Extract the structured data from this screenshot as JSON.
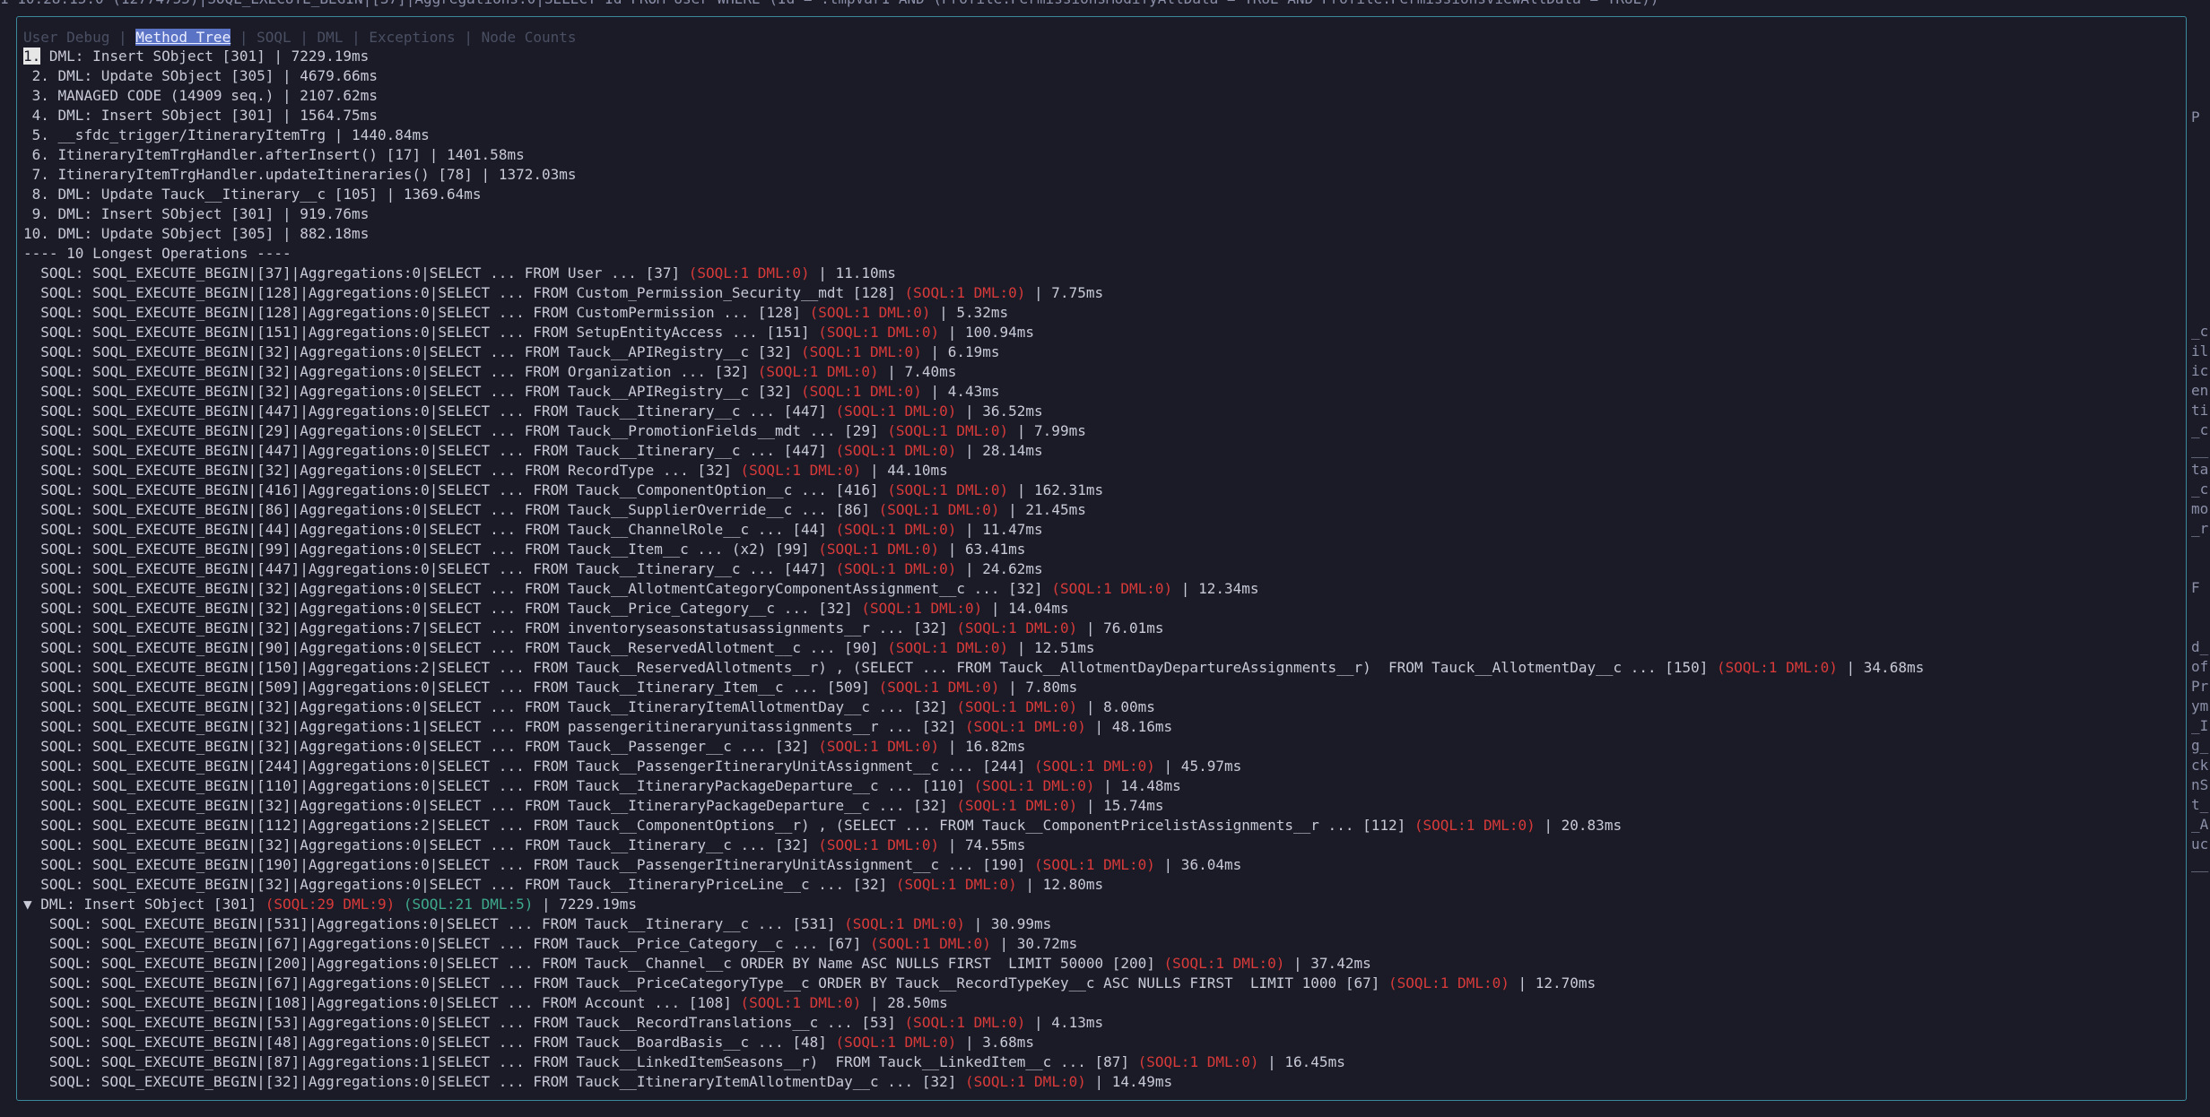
{
  "top_bar": "1 10:28:15.0 (12774755)|SOQL_EXECUTE_BEGIN|[37]|Aggregations:0|SELECT Id FROM User WHERE (Id = :tmpVar1 AND (Profile.PermissionsModifyAllData = TRUE AND Profile.PermissionsViewAllData = TRUE))",
  "tabs": [
    {
      "label": "User Debug",
      "active": false
    },
    {
      "label": "Method Tree",
      "active": true
    },
    {
      "label": "SOQL",
      "active": false
    },
    {
      "label": "DML",
      "active": false
    },
    {
      "label": "Exceptions",
      "active": false
    },
    {
      "label": "Node Counts",
      "active": false
    }
  ],
  "tab_separator": " | ",
  "longest": [
    {
      "prefix": "",
      "num": "1.",
      "text": " DML: Insert SObject [301] | 7229.19ms"
    },
    {
      "prefix": " ",
      "num": "2.",
      "text": " DML: Update SObject [305] | 4679.66ms"
    },
    {
      "prefix": " ",
      "num": "3.",
      "text": " MANAGED CODE (14909 seq.) | 2107.62ms"
    },
    {
      "prefix": " ",
      "num": "4.",
      "text": " DML: Insert SObject [301] | 1564.75ms"
    },
    {
      "prefix": " ",
      "num": "5.",
      "text": " __sfdc_trigger/ItineraryItemTrg | 1440.84ms"
    },
    {
      "prefix": " ",
      "num": "6.",
      "text": " ItineraryItemTrgHandler.afterInsert() [17] | 1401.58ms"
    },
    {
      "prefix": " ",
      "num": "7.",
      "text": " ItineraryItemTrgHandler.updateItineraries() [78] | 1372.03ms"
    },
    {
      "prefix": " ",
      "num": "8.",
      "text": " DML: Update Tauck__Itinerary__c [105] | 1369.64ms"
    },
    {
      "prefix": " ",
      "num": "9.",
      "text": " DML: Insert SObject [301] | 919.76ms"
    },
    {
      "prefix": "",
      "num": "10.",
      "text": " DML: Update SObject [305] | 882.18ms"
    }
  ],
  "longest_footer": "---- 10 Longest Operations ----",
  "soql_badge": "(SOQL:1 DML:0)",
  "soql_lines": [
    {
      "q": "  SOQL: SOQL_EXECUTE_BEGIN|[37]|Aggregations:0|SELECT ... FROM User ... [37] ",
      "t": " | 11.10ms"
    },
    {
      "q": "  SOQL: SOQL_EXECUTE_BEGIN|[128]|Aggregations:0|SELECT ... FROM Custom_Permission_Security__mdt [128] ",
      "t": " | 7.75ms"
    },
    {
      "q": "  SOQL: SOQL_EXECUTE_BEGIN|[128]|Aggregations:0|SELECT ... FROM CustomPermission ... [128] ",
      "t": " | 5.32ms"
    },
    {
      "q": "  SOQL: SOQL_EXECUTE_BEGIN|[151]|Aggregations:0|SELECT ... FROM SetupEntityAccess ... [151] ",
      "t": " | 100.94ms"
    },
    {
      "q": "  SOQL: SOQL_EXECUTE_BEGIN|[32]|Aggregations:0|SELECT ... FROM Tauck__APIRegistry__c [32] ",
      "t": " | 6.19ms"
    },
    {
      "q": "  SOQL: SOQL_EXECUTE_BEGIN|[32]|Aggregations:0|SELECT ... FROM Organization ... [32] ",
      "t": " | 7.40ms"
    },
    {
      "q": "  SOQL: SOQL_EXECUTE_BEGIN|[32]|Aggregations:0|SELECT ... FROM Tauck__APIRegistry__c [32] ",
      "t": " | 4.43ms"
    },
    {
      "q": "  SOQL: SOQL_EXECUTE_BEGIN|[447]|Aggregations:0|SELECT ... FROM Tauck__Itinerary__c ... [447] ",
      "t": " | 36.52ms"
    },
    {
      "q": "  SOQL: SOQL_EXECUTE_BEGIN|[29]|Aggregations:0|SELECT ... FROM Tauck__PromotionFields__mdt ... [29] ",
      "t": " | 7.99ms"
    },
    {
      "q": "  SOQL: SOQL_EXECUTE_BEGIN|[447]|Aggregations:0|SELECT ... FROM Tauck__Itinerary__c ... [447] ",
      "t": " | 28.14ms"
    },
    {
      "q": "  SOQL: SOQL_EXECUTE_BEGIN|[32]|Aggregations:0|SELECT ... FROM RecordType ... [32] ",
      "t": " | 44.10ms"
    },
    {
      "q": "  SOQL: SOQL_EXECUTE_BEGIN|[416]|Aggregations:0|SELECT ... FROM Tauck__ComponentOption__c ... [416] ",
      "t": " | 162.31ms"
    },
    {
      "q": "  SOQL: SOQL_EXECUTE_BEGIN|[86]|Aggregations:0|SELECT ... FROM Tauck__SupplierOverride__c ... [86] ",
      "t": " | 21.45ms"
    },
    {
      "q": "  SOQL: SOQL_EXECUTE_BEGIN|[44]|Aggregations:0|SELECT ... FROM Tauck__ChannelRole__c ... [44] ",
      "t": " | 11.47ms"
    },
    {
      "q": "  SOQL: SOQL_EXECUTE_BEGIN|[99]|Aggregations:0|SELECT ... FROM Tauck__Item__c ... (x2) [99] ",
      "t": " | 63.41ms"
    },
    {
      "q": "  SOQL: SOQL_EXECUTE_BEGIN|[447]|Aggregations:0|SELECT ... FROM Tauck__Itinerary__c ... [447] ",
      "t": " | 24.62ms"
    },
    {
      "q": "  SOQL: SOQL_EXECUTE_BEGIN|[32]|Aggregations:0|SELECT ... FROM Tauck__AllotmentCategoryComponentAssignment__c ... [32] ",
      "t": " | 12.34ms"
    },
    {
      "q": "  SOQL: SOQL_EXECUTE_BEGIN|[32]|Aggregations:0|SELECT ... FROM Tauck__Price_Category__c ... [32] ",
      "t": " | 14.04ms"
    },
    {
      "q": "  SOQL: SOQL_EXECUTE_BEGIN|[32]|Aggregations:7|SELECT ... FROM inventoryseasonstatusassignments__r ... [32] ",
      "t": " | 76.01ms"
    },
    {
      "q": "  SOQL: SOQL_EXECUTE_BEGIN|[90]|Aggregations:0|SELECT ... FROM Tauck__ReservedAllotment__c ... [90] ",
      "t": " | 12.51ms"
    },
    {
      "q": "  SOQL: SOQL_EXECUTE_BEGIN|[150]|Aggregations:2|SELECT ... FROM Tauck__ReservedAllotments__r) , (SELECT ... FROM Tauck__AllotmentDayDepartureAssignments__r)  FROM Tauck__AllotmentDay__c ... [150] ",
      "t": " | 34.68ms"
    },
    {
      "q": "  SOQL: SOQL_EXECUTE_BEGIN|[509]|Aggregations:0|SELECT ... FROM Tauck__Itinerary_Item__c ... [509] ",
      "t": " | 7.80ms"
    },
    {
      "q": "  SOQL: SOQL_EXECUTE_BEGIN|[32]|Aggregations:0|SELECT ... FROM Tauck__ItineraryItemAllotmentDay__c ... [32] ",
      "t": " | 8.00ms"
    },
    {
      "q": "  SOQL: SOQL_EXECUTE_BEGIN|[32]|Aggregations:1|SELECT ... FROM passengeritineraryunitassignments__r ... [32] ",
      "t": " | 48.16ms"
    },
    {
      "q": "  SOQL: SOQL_EXECUTE_BEGIN|[32]|Aggregations:0|SELECT ... FROM Tauck__Passenger__c ... [32] ",
      "t": " | 16.82ms"
    },
    {
      "q": "  SOQL: SOQL_EXECUTE_BEGIN|[244]|Aggregations:0|SELECT ... FROM Tauck__PassengerItineraryUnitAssignment__c ... [244] ",
      "t": " | 45.97ms"
    },
    {
      "q": "  SOQL: SOQL_EXECUTE_BEGIN|[110]|Aggregations:0|SELECT ... FROM Tauck__ItineraryPackageDeparture__c ... [110] ",
      "t": " | 14.48ms"
    },
    {
      "q": "  SOQL: SOQL_EXECUTE_BEGIN|[32]|Aggregations:0|SELECT ... FROM Tauck__ItineraryPackageDeparture__c ... [32] ",
      "t": " | 15.74ms"
    },
    {
      "q": "  SOQL: SOQL_EXECUTE_BEGIN|[112]|Aggregations:2|SELECT ... FROM Tauck__ComponentOptions__r) , (SELECT ... FROM Tauck__ComponentPricelistAssignments__r ... [112] ",
      "t": " | 20.83ms"
    },
    {
      "q": "  SOQL: SOQL_EXECUTE_BEGIN|[32]|Aggregations:0|SELECT ... FROM Tauck__Itinerary__c ... [32] ",
      "t": " | 74.55ms"
    },
    {
      "q": "  SOQL: SOQL_EXECUTE_BEGIN|[190]|Aggregations:0|SELECT ... FROM Tauck__PassengerItineraryUnitAssignment__c ... [190] ",
      "t": " | 36.04ms"
    },
    {
      "q": "  SOQL: SOQL_EXECUTE_BEGIN|[32]|Aggregations:0|SELECT ... FROM Tauck__ItineraryPriceLine__c ... [32] ",
      "t": " | 12.80ms"
    }
  ],
  "tree_node": {
    "arrow": "▼",
    "label": " DML: Insert SObject [301] ",
    "total_badge": "(SOQL:29 DML:9)",
    "self_badge": "(SOQL:21 DML:5)",
    "time": " | 7229.19ms"
  },
  "child_lines": [
    {
      "q": "   SOQL: SOQL_EXECUTE_BEGIN|[531]|Aggregations:0|SELECT ... FROM Tauck__Itinerary__c ... [531] ",
      "t": " | 30.99ms"
    },
    {
      "q": "   SOQL: SOQL_EXECUTE_BEGIN|[67]|Aggregations:0|SELECT ... FROM Tauck__Price_Category__c ... [67] ",
      "t": " | 30.72ms"
    },
    {
      "q": "   SOQL: SOQL_EXECUTE_BEGIN|[200]|Aggregations:0|SELECT ... FROM Tauck__Channel__c ORDER BY Name ASC NULLS FIRST  LIMIT 50000 [200] ",
      "t": " | 37.42ms"
    },
    {
      "q": "   SOQL: SOQL_EXECUTE_BEGIN|[67]|Aggregations:0|SELECT ... FROM Tauck__PriceCategoryType__c ORDER BY Tauck__RecordTypeKey__c ASC NULLS FIRST  LIMIT 1000 [67] ",
      "t": " | 12.70ms"
    },
    {
      "q": "   SOQL: SOQL_EXECUTE_BEGIN|[108]|Aggregations:0|SELECT ... FROM Account ... [108] ",
      "t": " | 28.50ms"
    },
    {
      "q": "   SOQL: SOQL_EXECUTE_BEGIN|[53]|Aggregations:0|SELECT ... FROM Tauck__RecordTranslations__c ... [53] ",
      "t": " | 4.13ms"
    },
    {
      "q": "   SOQL: SOQL_EXECUTE_BEGIN|[48]|Aggregations:0|SELECT ... FROM Tauck__BoardBasis__c ... [48] ",
      "t": " | 3.68ms"
    },
    {
      "q": "   SOQL: SOQL_EXECUTE_BEGIN|[87]|Aggregations:1|SELECT ... FROM Tauck__LinkedItemSeasons__r)  FROM Tauck__LinkedItem__c ... [87] ",
      "t": " | 16.45ms"
    },
    {
      "q": "   SOQL: SOQL_EXECUTE_BEGIN|[32]|Aggregations:0|SELECT ... FROM Tauck__ItineraryItemAllotmentDay__c ... [32] ",
      "t": " | 14.49ms"
    }
  ],
  "right_edge": [
    "P",
    "",
    "",
    "",
    "",
    "",
    "",
    "",
    "",
    "",
    "",
    "",
    "",
    "_c",
    "il",
    "ic",
    "en",
    "ti",
    "_c",
    "__",
    "ta",
    "_c",
    "mo",
    "_r",
    "",
    "",
    "F",
    "",
    "",
    "d_",
    "of",
    "Pr",
    "ym",
    "_I",
    "g_",
    "ck",
    "nS",
    "t_",
    "_A",
    "uc",
    "__"
  ],
  "colors": {
    "accent": "#3a8a9c",
    "badge_red": "#d83a3a",
    "badge_green": "#3fa98c",
    "tab_active_bg": "#5b73c4"
  }
}
